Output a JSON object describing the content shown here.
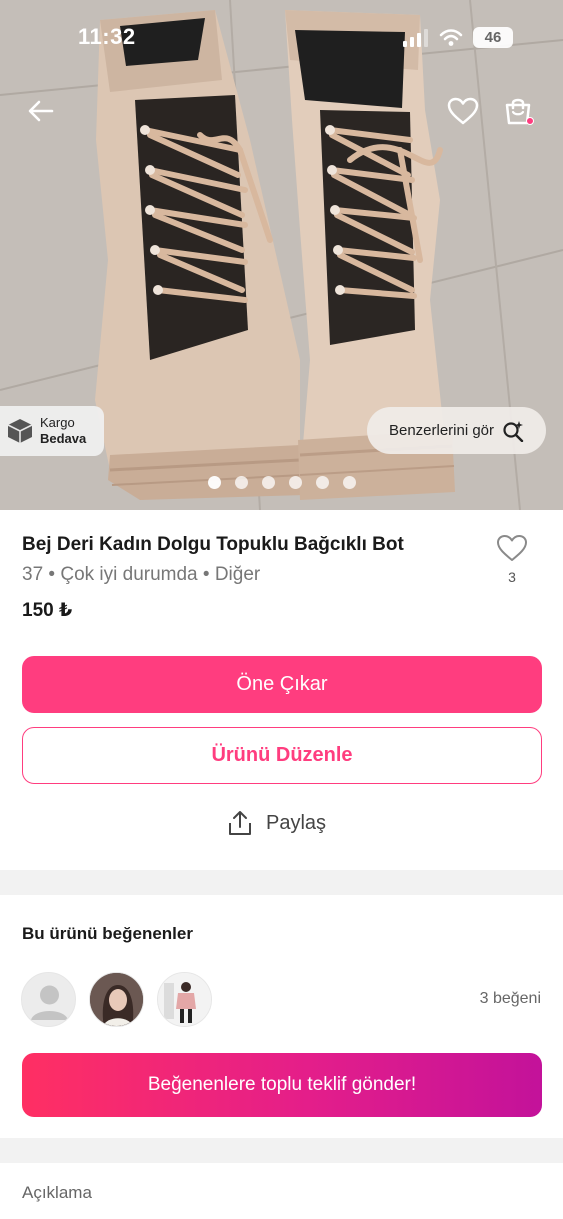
{
  "status_bar": {
    "time": "11:32",
    "battery": "46"
  },
  "hero": {
    "cargo_badge": {
      "line1": "Kargo",
      "line2": "Bedava"
    },
    "similar_button": "Benzerlerini gör",
    "image_count": 6,
    "active_image_index": 0
  },
  "product": {
    "title": "Bej Deri Kadın Dolgu Topuklu Bağcıklı Bot",
    "meta": "37 • Çok iyi durumda • Diğer",
    "price": "150 ₺",
    "like_count": "3"
  },
  "actions": {
    "promote": "Öne Çıkar",
    "edit": "Ürünü Düzenle",
    "share": "Paylaş"
  },
  "likers": {
    "title": "Bu ürünü beğenenler",
    "total": "3 beğeni",
    "bulk_offer": "Beğenenlere toplu teklif gönder!"
  },
  "description": {
    "title": "Açıklama"
  },
  "colors": {
    "accent": "#ff3d7f",
    "gradient_start": "#ff2f63",
    "gradient_end": "#c3129a"
  }
}
